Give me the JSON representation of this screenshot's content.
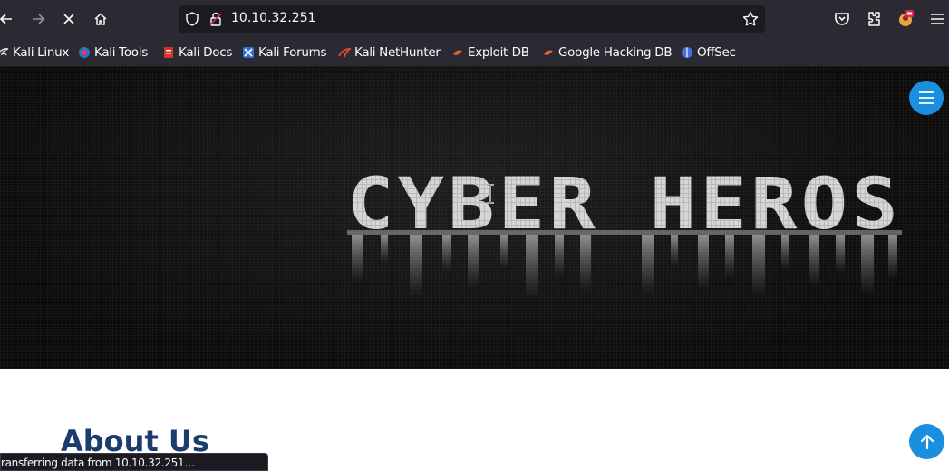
{
  "browser": {
    "url": "10.10.32.251",
    "status_text": "ransferring data from 10.10.32.251…",
    "icons": [
      "back-icon",
      "forward-icon",
      "stop-icon",
      "home-icon",
      "shield-icon",
      "lock-icon",
      "star-icon",
      "pocket-icon",
      "extensions-icon",
      "profile-icon",
      "menu-icon"
    ]
  },
  "bookmarks": [
    {
      "label": "Kali Linux",
      "icon": "kali-icon"
    },
    {
      "label": "Kali Tools",
      "icon": "kali-tools-icon"
    },
    {
      "label": "Kali Docs",
      "icon": "kali-docs-icon"
    },
    {
      "label": "Kali Forums",
      "icon": "kali-forums-icon"
    },
    {
      "label": "Kali NetHunter",
      "icon": "nethunter-icon"
    },
    {
      "label": "Exploit-DB",
      "icon": "exploit-db-icon"
    },
    {
      "label": "Google Hacking DB",
      "icon": "ghdb-icon"
    },
    {
      "label": "OffSec",
      "icon": "offsec-icon"
    }
  ],
  "page": {
    "hero_title": "CYBER HEROS",
    "about_heading": "About Us"
  },
  "colors": {
    "toolbar_bg": "#2b2a33",
    "accent_blue": "#1a8fe0",
    "heading_navy": "#1a3d6e"
  }
}
